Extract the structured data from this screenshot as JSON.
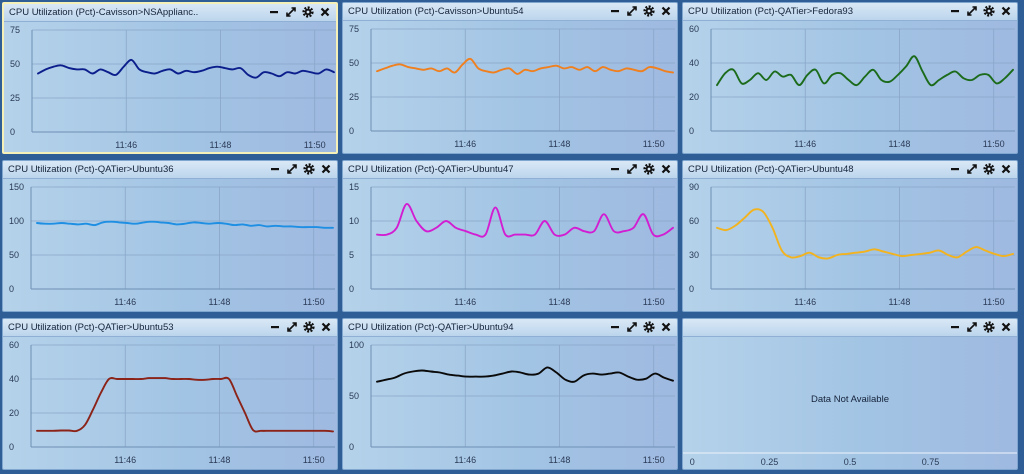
{
  "panel_controls": {
    "minimize": "minimize-icon",
    "maximize": "expand-icon",
    "settings": "gear-icon",
    "close": "close-icon"
  },
  "x_axis": {
    "ticks": [
      "11:46",
      "11:48",
      "11:50"
    ]
  },
  "panels": [
    {
      "title": "CPU Utilization (Pct)-Cavisson>NSApplianc..",
      "selected": true,
      "color": "#0b1e8c",
      "ylim": [
        0,
        75
      ],
      "yticks": [
        "75",
        "50",
        "25",
        "0"
      ],
      "values": [
        43,
        46,
        48,
        49,
        47,
        46,
        46,
        43,
        46,
        44,
        42,
        48,
        53,
        46,
        44,
        43,
        45,
        46,
        43,
        45,
        44,
        45,
        47,
        48,
        47,
        46,
        47,
        42,
        40,
        44,
        43,
        41,
        44,
        43,
        45,
        44,
        43,
        46,
        44
      ]
    },
    {
      "title": "CPU Utilization (Pct)-Cavisson>Ubuntu54",
      "selected": false,
      "color": "#f07f1e",
      "ylim": [
        0,
        75
      ],
      "yticks": [
        "75",
        "50",
        "25",
        "0"
      ],
      "values": [
        44,
        46,
        48,
        49,
        47,
        46,
        45,
        46,
        44,
        46,
        43,
        49,
        53,
        46,
        44,
        43,
        45,
        46,
        42,
        45,
        44,
        46,
        47,
        48,
        46,
        47,
        45,
        47,
        44,
        47,
        45,
        44,
        46,
        45,
        44,
        47,
        46,
        44,
        43
      ]
    },
    {
      "title": "CPU Utilization (Pct)-QATier>Fedora93",
      "selected": false,
      "color": "#1b6b1b",
      "ylim": [
        0,
        60
      ],
      "yticks": [
        "60",
        "40",
        "20",
        "0"
      ],
      "values": [
        27,
        34,
        36,
        28,
        30,
        34,
        30,
        35,
        32,
        33,
        27,
        33,
        36,
        28,
        33,
        34,
        30,
        27,
        32,
        36,
        30,
        29,
        33,
        38,
        44,
        35,
        27,
        30,
        33,
        35,
        31,
        30,
        33,
        33,
        28,
        31,
        36
      ]
    },
    {
      "title": "CPU Utilization (Pct)-QATier>Ubuntu36",
      "selected": false,
      "color": "#1e8fe3",
      "ylim": [
        0,
        150
      ],
      "yticks": [
        "150",
        "100",
        "50",
        "0"
      ],
      "values": [
        97,
        96,
        96,
        97,
        96,
        95,
        96,
        94,
        98,
        99,
        98,
        97,
        96,
        98,
        99,
        98,
        97,
        95,
        96,
        98,
        97,
        96,
        97,
        96,
        94,
        95,
        93,
        94,
        92,
        93,
        92,
        92,
        91,
        91,
        91,
        90,
        90
      ]
    },
    {
      "title": "CPU Utilization (Pct)-QATier>Ubuntu47",
      "selected": false,
      "color": "#d21ed2",
      "ylim": [
        0,
        15
      ],
      "yticks": [
        "15",
        "10",
        "5",
        "0"
      ],
      "values": [
        8,
        8,
        9,
        12.5,
        10,
        8.5,
        9,
        10,
        9,
        8.5,
        8,
        8,
        12,
        8,
        8,
        8,
        8,
        10,
        8,
        8,
        9,
        8.5,
        8.5,
        11,
        8.5,
        8.5,
        9,
        11,
        8,
        8,
        9
      ]
    },
    {
      "title": "CPU Utilization (Pct)-QATier>Ubuntu48",
      "selected": false,
      "color": "#f2b31e",
      "ylim": [
        0,
        90
      ],
      "yticks": [
        "90",
        "60",
        "30",
        "0"
      ],
      "values": [
        54,
        52,
        56,
        63,
        70,
        68,
        54,
        34,
        28,
        29,
        32,
        28,
        27,
        30,
        31,
        32,
        33,
        35,
        33,
        31,
        29,
        30,
        31,
        32,
        34,
        30,
        28,
        33,
        37,
        34,
        31,
        29,
        31
      ]
    },
    {
      "title": "CPU Utilization (Pct)-QATier>Ubuntu53",
      "selected": false,
      "color": "#8b2318",
      "ylim": [
        0,
        60
      ],
      "yticks": [
        "60",
        "40",
        "20",
        "0"
      ],
      "values": [
        9.5,
        9.5,
        9.5,
        9.7,
        9.7,
        9.5,
        13,
        22,
        32,
        40,
        40,
        40,
        40,
        40,
        40.5,
        40.5,
        40.5,
        40,
        40,
        40,
        39.5,
        39.5,
        40,
        40,
        40,
        30,
        20,
        10,
        9.5,
        9.5,
        9.5,
        9.5,
        9.5,
        9.5,
        9.5,
        9.5,
        9.5,
        9.2
      ]
    },
    {
      "title": "CPU Utilization (Pct)-QATier>Ubuntu94",
      "selected": false,
      "color": "#0a0a0a",
      "ylim": [
        0,
        100
      ],
      "yticks": [
        "100",
        "50",
        "0"
      ],
      "values": [
        64,
        66,
        68,
        72,
        74,
        75,
        74,
        73,
        71,
        70,
        69,
        69,
        69,
        70,
        72,
        74,
        73,
        71,
        72,
        78,
        73,
        66,
        64,
        70,
        72,
        71,
        72,
        73,
        69,
        66,
        67,
        72,
        68,
        65
      ]
    },
    {
      "title": "",
      "selected": false,
      "no_data": true,
      "message": "Data Not Available",
      "xticks": [
        "0",
        "0.25",
        "0.5",
        "0.75"
      ]
    }
  ]
}
